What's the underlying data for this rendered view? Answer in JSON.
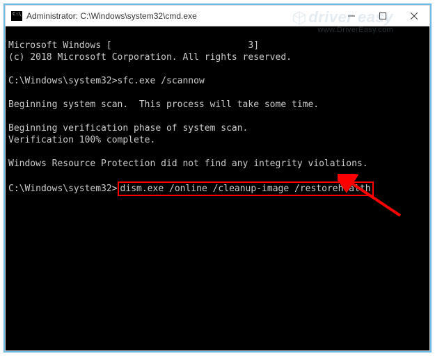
{
  "window": {
    "title": "Administrator: C:\\Windows\\system32\\cmd.exe"
  },
  "terminal": {
    "header1": "Microsoft Windows [                         3]",
    "header2": "(c) 2018 Microsoft Corporation. All rights reserved.",
    "blank": "",
    "prompt1_path": "C:\\Windows\\system32>",
    "prompt1_cmd": "sfc.exe /scannow",
    "scan_begin": "Beginning system scan.  This process will take some time.",
    "verify_begin": "Beginning verification phase of system scan.",
    "verify_done": "Verification 100% complete.",
    "wrp_result": "Windows Resource Protection did not find any integrity violations.",
    "prompt2_path": "C:\\Windows\\system32>",
    "prompt2_cmd": "dism.exe /online /cleanup-image /restorehealth"
  },
  "watermark": {
    "brand": "driver easy",
    "url": "www.DriverEasy.com"
  }
}
